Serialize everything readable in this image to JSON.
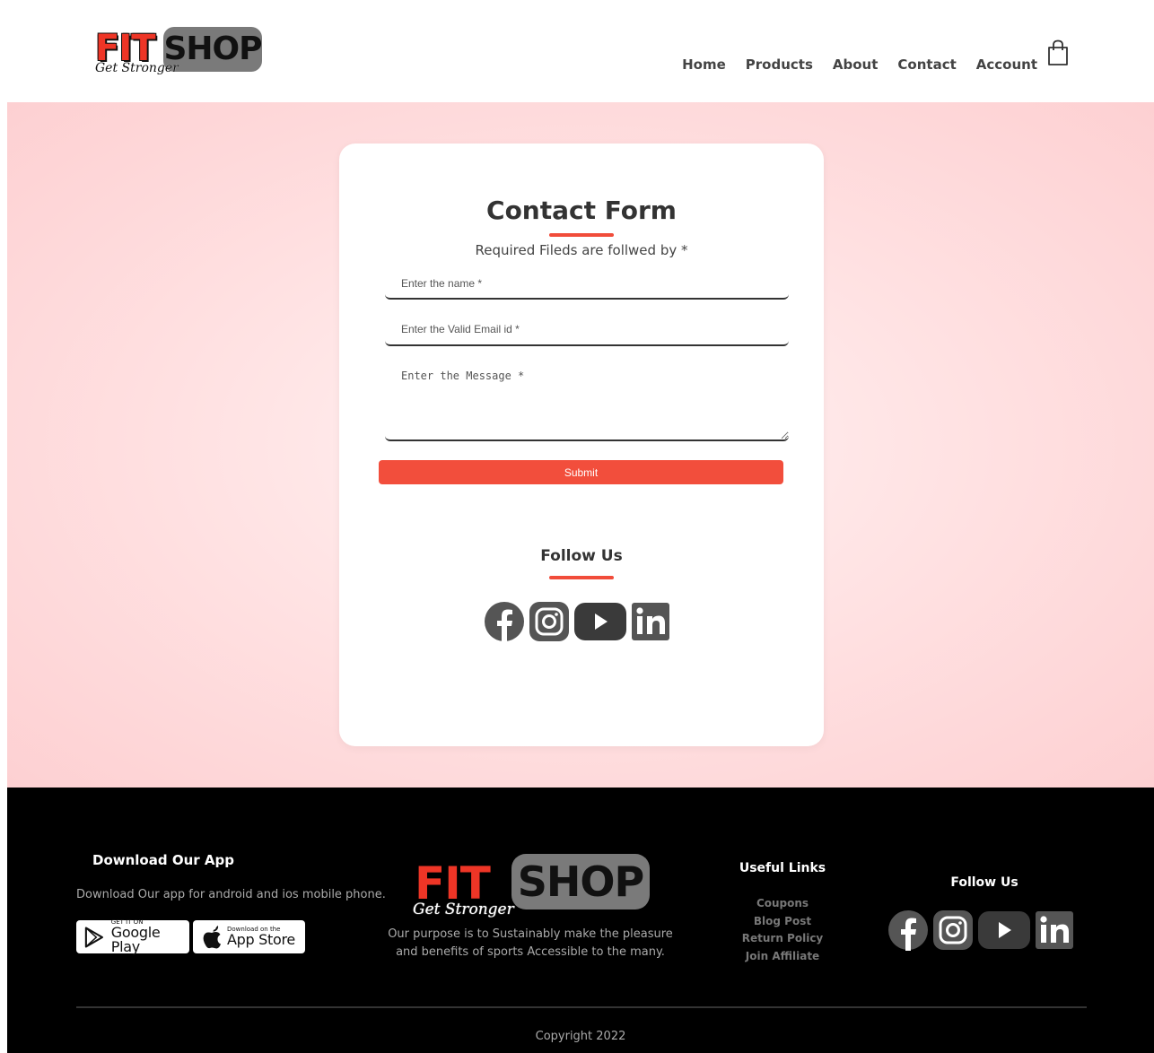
{
  "brand": {
    "fit": "FIT",
    "shop": "SHOP",
    "tagline": "Get Stronger"
  },
  "nav": {
    "items": [
      {
        "label": "Home"
      },
      {
        "label": "Products"
      },
      {
        "label": "About"
      },
      {
        "label": "Contact"
      },
      {
        "label": "Account"
      }
    ],
    "cart_icon": "shopping-bag-icon"
  },
  "form": {
    "title": "Contact Form",
    "subtitle": "Required Fileds are follwed by *",
    "name_placeholder": "Enter the name *",
    "email_placeholder": "Enter the Valid Email id *",
    "message_placeholder": "Enter the Message *",
    "submit_label": "Submit"
  },
  "follow": {
    "title": "Follow Us",
    "icons": [
      "facebook-icon",
      "instagram-icon",
      "youtube-icon",
      "linkedin-icon"
    ]
  },
  "footer": {
    "app_title": "Download Our App",
    "app_text": "Download Our app for android and ios mobile phone.",
    "google_play": {
      "small": "GET IT ON",
      "big": "Google Play"
    },
    "app_store": {
      "small": "Download on the",
      "big": "App Store"
    },
    "purpose": "Our purpose is to Sustainably make the pleasure and benefits of sports Accessible to the many.",
    "links_title": "Useful Links",
    "links": [
      "Coupons",
      "Blog Post",
      "Return Policy",
      "Join Affiliate"
    ],
    "follow_title": "Follow Us",
    "copyright": "Copyright 2022"
  },
  "colors": {
    "accent": "#f24e3c",
    "logo_red": "#ee3526",
    "logo_grey": "#7a7a7a",
    "icon_grey": "#555555",
    "footer_bg": "#000000"
  }
}
